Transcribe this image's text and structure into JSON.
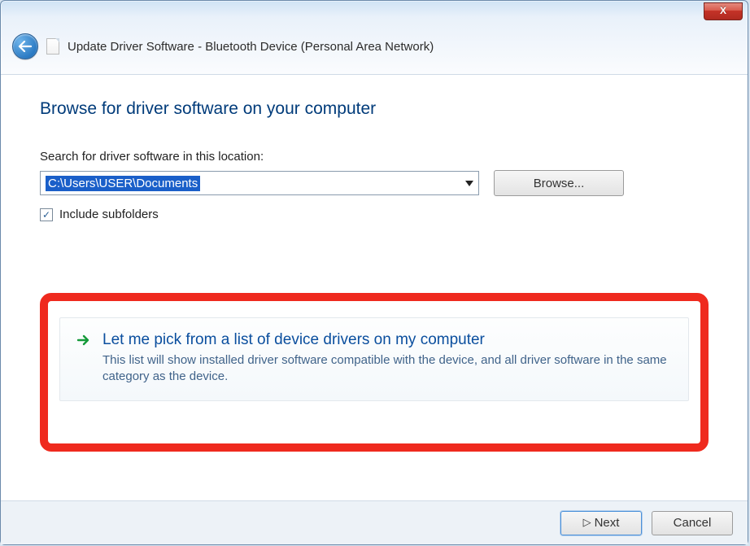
{
  "window": {
    "title": "Update Driver Software - Bluetooth Device (Personal Area Network)",
    "close_label": "X"
  },
  "main": {
    "heading": "Browse for driver software on your computer",
    "search_label": "Search for driver software in this location:",
    "path_value": "C:\\Users\\USER\\Documents",
    "browse_label": "Browse...",
    "include_subfolders_label": "Include subfolders",
    "include_subfolders_checked": "✓"
  },
  "option": {
    "title": "Let me pick from a list of device drivers on my computer",
    "description": "This list will show installed driver software compatible with the device, and all driver software in the same category as the device."
  },
  "footer": {
    "next_label": "Next",
    "cancel_label": "Cancel"
  }
}
